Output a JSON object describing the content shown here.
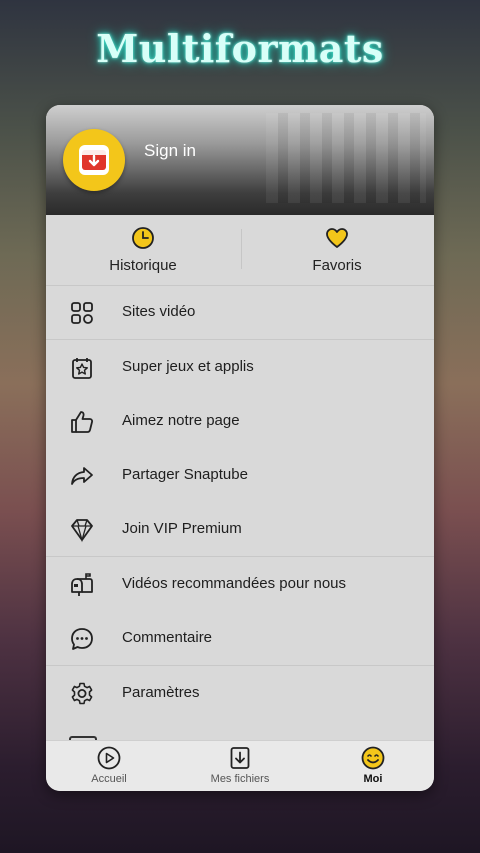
{
  "headline": "Multiformats",
  "profile": {
    "signin_label": "Sign in"
  },
  "quick_actions": [
    {
      "label": "Historique",
      "icon": "clock-icon"
    },
    {
      "label": "Favoris",
      "icon": "heart-icon"
    }
  ],
  "menu": [
    {
      "label": "Sites vidéo",
      "icon": "grid-icon"
    },
    {
      "label": "Super jeux et applis",
      "icon": "star-badge-icon"
    },
    {
      "label": "Aimez notre page",
      "icon": "thumbs-up-icon"
    },
    {
      "label": "Partager Snaptube",
      "icon": "share-arrow-icon"
    },
    {
      "label": "Join VIP Premium",
      "icon": "diamond-icon"
    },
    {
      "label": "Vidéos recommandées pour nous",
      "icon": "mailbox-icon"
    },
    {
      "label": "Commentaire",
      "icon": "chat-bubble-icon"
    },
    {
      "label": "Paramètres",
      "icon": "gear-icon"
    }
  ],
  "bottom_nav": [
    {
      "label": "Accueil",
      "icon": "play-circle-icon",
      "active": false
    },
    {
      "label": "Mes fichiers",
      "icon": "download-file-icon",
      "active": false
    },
    {
      "label": "Moi",
      "icon": "smiley-icon",
      "active": true
    }
  ],
  "colors": {
    "accent_yellow": "#f3c61a",
    "app_red": "#e0352b",
    "headline_glow": "#27d9c2"
  }
}
